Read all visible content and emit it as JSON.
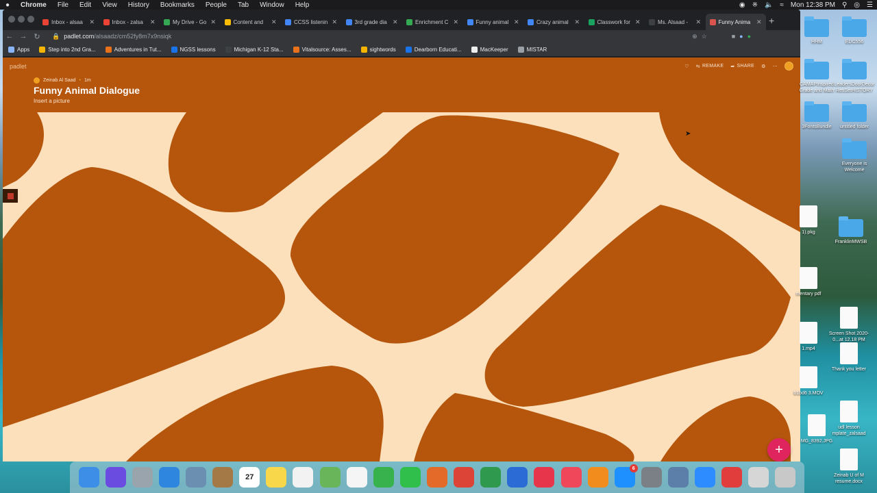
{
  "menubar": {
    "apple": "",
    "items": [
      "Chrome",
      "File",
      "Edit",
      "View",
      "History",
      "Bookmarks",
      "People",
      "Tab",
      "Window",
      "Help"
    ],
    "clock": "Mon 12:38 PM"
  },
  "tabs": [
    {
      "label": "Inbox - alsaa",
      "color": "#ea4335"
    },
    {
      "label": "Inbox - zalsa",
      "color": "#ea4335"
    },
    {
      "label": "My Drive - Go",
      "color": "#34a853"
    },
    {
      "label": "Content and",
      "color": "#fbbc04"
    },
    {
      "label": "CCSS listenin",
      "color": "#4285f4"
    },
    {
      "label": "3rd grade dia",
      "color": "#4285f4"
    },
    {
      "label": "Enrichment C",
      "color": "#34a853"
    },
    {
      "label": "Funny animal",
      "color": "#4285f4"
    },
    {
      "label": "Crazy animal",
      "color": "#4285f4"
    },
    {
      "label": "Classwork for",
      "color": "#1aa260"
    },
    {
      "label": "Ms. Alsaad -",
      "color": "#3c4043"
    },
    {
      "label": "Funny Anima",
      "color": "#d9534f"
    }
  ],
  "address": {
    "host": "padlet.com",
    "path": "/alsaadz/cm52fy8m7x9nsiqk"
  },
  "bookmarks": [
    {
      "label": "Apps",
      "color": "#8ab4f8"
    },
    {
      "label": "Step into 2nd Gra...",
      "color": "#f4b400"
    },
    {
      "label": "Adventures in Tut...",
      "color": "#e8711a"
    },
    {
      "label": "NGSS lessons",
      "color": "#1a73e8"
    },
    {
      "label": "Michigan K-12 Sta...",
      "color": "#3c4043"
    },
    {
      "label": "Vitalsource: Asses...",
      "color": "#e8711a"
    },
    {
      "label": "sightwords",
      "color": "#f4b400"
    },
    {
      "label": "Dearborn Educati...",
      "color": "#1a73e8"
    },
    {
      "label": "MacKeeper",
      "color": "#eeeeee"
    },
    {
      "label": "MISTAR",
      "color": "#9aa0a6"
    }
  ],
  "padlet": {
    "logo": "padlet",
    "author": "Zeinab Al Saad",
    "time": "1m",
    "title": "Funny Animal Dialogue",
    "description": "Insert a picture",
    "actions": {
      "remake": "REMAKE",
      "share": "SHARE"
    },
    "fab": "+",
    "colors": {
      "spot": "#b5560c",
      "bg": "#fce0bc"
    }
  },
  "desktop": {
    "items": [
      {
        "label": "HHM",
        "type": "folder"
      },
      {
        "label": "EDC556",
        "type": "folder"
      },
      {
        "label": "CAMAPInspired Grade and Math",
        "type": "folder"
      },
      {
        "label": "LeadersDoorDecor ResSetHISTORY",
        "type": "folder"
      },
      {
        "label": "3FontsBundle",
        "type": "folder"
      },
      {
        "label": "untitled folder",
        "type": "folder"
      },
      {
        "label": "Everyone is Welcome",
        "type": "folder"
      },
      {
        "label": "1).pkg",
        "type": "doc"
      },
      {
        "label": "FranklinMWSB",
        "type": "folder"
      },
      {
        "label": "mentary pdf",
        "type": "doc"
      },
      {
        "label": "Screen Shot 2020-0...at 12.18 PM",
        "type": "doc"
      },
      {
        "label": "1.mp4",
        "type": "doc"
      },
      {
        "label": "Thank you letter",
        "type": "doc"
      },
      {
        "label": "b1bd6 3.MOV",
        "type": "doc"
      },
      {
        "label": "udl lesson mplate_zalsaad",
        "type": "doc"
      },
      {
        "label": "MG_8392.JPG",
        "type": "doc"
      },
      {
        "label": "Zeinab U of M resume.docx",
        "type": "doc"
      }
    ]
  },
  "dock": {
    "apps": [
      {
        "name": "finder",
        "color": "#3d8ee6"
      },
      {
        "name": "siri",
        "color": "#6b4ce0"
      },
      {
        "name": "launchpad",
        "color": "#9aa4ad"
      },
      {
        "name": "safari",
        "color": "#2e86de"
      },
      {
        "name": "preview",
        "color": "#6b8fb0"
      },
      {
        "name": "contacts",
        "color": "#a57946"
      },
      {
        "name": "calendar",
        "color": "#ffffff",
        "text": "27"
      },
      {
        "name": "notes",
        "color": "#f8d84a"
      },
      {
        "name": "reminders",
        "color": "#f2f2f2"
      },
      {
        "name": "maps",
        "color": "#68b55a"
      },
      {
        "name": "photos",
        "color": "#f5f5f5"
      },
      {
        "name": "messages",
        "color": "#37b24d"
      },
      {
        "name": "facetime",
        "color": "#2fbf4a"
      },
      {
        "name": "keynote-slides",
        "color": "#e46a2a"
      },
      {
        "name": "chrome",
        "color": "#db4437"
      },
      {
        "name": "numbers",
        "color": "#2f9a4d"
      },
      {
        "name": "keynote",
        "color": "#2a6bd6"
      },
      {
        "name": "news",
        "color": "#e7364c"
      },
      {
        "name": "music",
        "color": "#f0475a"
      },
      {
        "name": "books",
        "color": "#f28c1d"
      },
      {
        "name": "app-store",
        "color": "#1e90ff",
        "badge": "6"
      },
      {
        "name": "system-preferences",
        "color": "#7b7f86"
      },
      {
        "name": "image-capture",
        "color": "#5b7fa8"
      },
      {
        "name": "zoom",
        "color": "#2d8cff"
      },
      {
        "name": "creative-cloud",
        "color": "#e23d3d"
      },
      {
        "name": "downloads",
        "color": "#d6d6d6"
      },
      {
        "name": "trash",
        "color": "#c8c8c8"
      }
    ]
  }
}
